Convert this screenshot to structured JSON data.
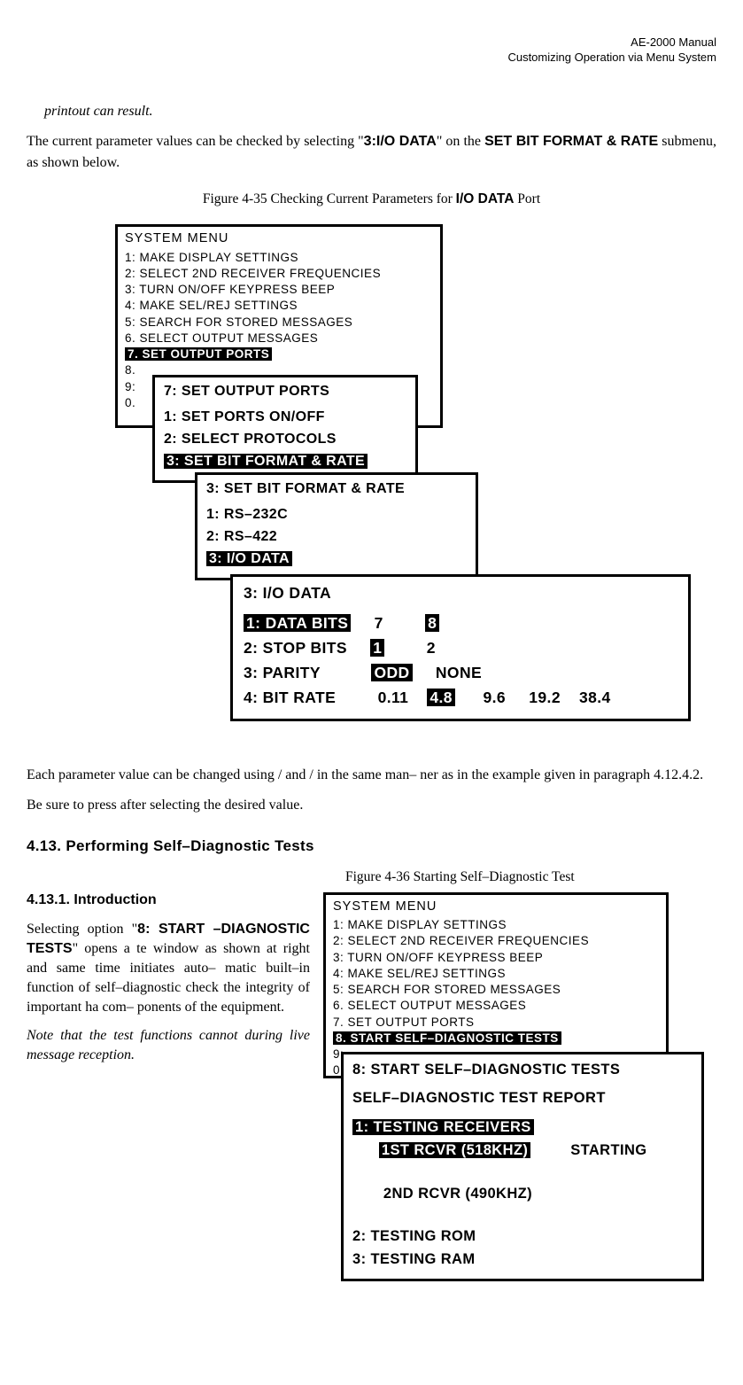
{
  "header": {
    "line1": "AE-2000 Manual",
    "line2": "Customizing Operation via Menu System"
  },
  "para_italic1": "printout can result.",
  "para1_a": "The current parameter values can be checked by selecting \"",
  "para1_b": "3:I/O DATA",
  "para1_c": "\" on the ",
  "para1_d": "SET BIT FORMAT & RATE",
  "para1_e": " submenu, as shown below.",
  "fig35_a": "Figure 4-35   Checking Current Parameters for ",
  "fig35_b": "I/O DATA",
  "fig35_c": " Port",
  "menu1": {
    "title": "SYSTEM MENU",
    "i1": "1:   MAKE DISPLAY SETTINGS",
    "i2": "2:    SELECT 2ND RECEIVER FREQUENCIES",
    "i3": "3:    TURN ON/OFF KEYPRESS BEEP",
    "i4": "4:    MAKE SEL/REJ SETTINGS",
    "i5": "5:    SEARCH FOR STORED MESSAGES",
    "i6": "6.    SELECT OUTPUT MESSAGES",
    "i7a": "7.    SET OUTPUT PORTS",
    "i8": "8.",
    "i9": "9:",
    "i0": "0."
  },
  "menu2": {
    "title": "7: SET OUTPUT PORTS",
    "i1": "1: SET PORTS ON/OFF",
    "i2": "2: SELECT PROTOCOLS",
    "i3": "3: SET BIT FORMAT & RATE"
  },
  "menu3": {
    "title": "3: SET BIT FORMAT & RATE",
    "i1": "1: RS–232C",
    "i2": "2: RS–422",
    "i3": "3: I/O DATA"
  },
  "menu4": {
    "title": "3: I/O DATA",
    "r1_label": "1: DATA BITS",
    "r1_v1": "7",
    "r1_v2": "8",
    "r2_label": "2: STOP BITS",
    "r2_v1": "1",
    "r2_v2": "2",
    "r3_label": "3: PARITY",
    "r3_v1": "ODD",
    "r3_v2": "NONE",
    "r4_label": "4: BIT RATE",
    "r4_v1": "0.11",
    "r4_v2": "4.8",
    "r4_v3": "9.6",
    "r4_v4": "19.2",
    "r4_v5": "38.4"
  },
  "para2": "Each parameter value can be changed using       /      and      /      in the same man– ner as in the example given in paragraph 4.12.4.2.",
  "para3": "Be sure to press        after selecting the desired value.",
  "sec413": "4.13.  Performing Self–Diagnostic Tests",
  "sec4131": "4.13.1.    Introduction",
  "fig36_a": "Figure 4-36   Starting Self–Diagnostic Test",
  "para4_a": "Selecting option \"",
  "para4_b": "8: START –DIAGNOSTIC TESTS",
  "para4_c": "\" opens a te window   as shown at right and same time initiates auto– matic built–in function of self–diagnostic check the integrity of important ha com– ponents of the equipment.",
  "para5": "Note that the test functions cannot during live message reception.",
  "menu5": {
    "title": "SYSTEM MENU",
    "i1": "1:   MAKE DISPLAY SETTINGS",
    "i2": "2:    SELECT 2ND RECEIVER FREQUENCIES",
    "i3": "3:    TURN ON/OFF KEYPRESS BEEP",
    "i4": "4:    MAKE SEL/REJ SETTINGS",
    "i5": "5:    SEARCH FOR STORED MESSAGES",
    "i6": "6.    SELECT OUTPUT MESSAGES",
    "i7": "7.    SET OUTPUT PORTS",
    "i8": "8.    START SELF–DIAGNOSTIC TESTS",
    "i9": "9:",
    "i0": "0."
  },
  "menu6": {
    "title": "8: START SELF–DIAGNOSTIC TESTS",
    "sub": "SELF–DIAGNOSTIC TEST REPORT",
    "r1": "1: TESTING RECEIVERS",
    "r1a": "1ST RCVR (518KHZ)",
    "r1b": "STARTING",
    "r2": "2ND RCVR (490KHZ)",
    "r3": "2: TESTING ROM",
    "r4": "3: TESTING RAM"
  }
}
